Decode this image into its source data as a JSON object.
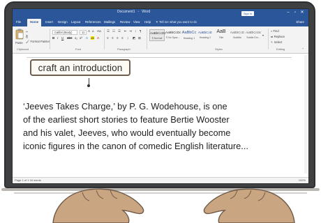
{
  "word": {
    "title_tokens": [
      "Document1",
      "-",
      "Word"
    ],
    "signin_label": "Sign in",
    "window_buttons": [
      "–",
      "▫",
      "✕"
    ],
    "tabs": [
      "File",
      "Home",
      "Insert",
      "Design",
      "Layout",
      "References",
      "Mailings",
      "Review",
      "View",
      "Help"
    ],
    "tell_me": "Tell me what you want to do",
    "share_label": "Share",
    "ribbon": {
      "font_name": "Calibri (Body)",
      "font_size": "11",
      "format_painter": "Format Painter",
      "paste_label": "Paste",
      "groups": [
        "Clipboard",
        "Font",
        "Paragraph",
        "Styles",
        "Editing"
      ],
      "styles": [
        {
          "sample": "AaBbCcDc",
          "name": "¶ Normal"
        },
        {
          "sample": "AaBbCcDc",
          "name": "¶ No Spac..."
        },
        {
          "sample": "AaBbCc",
          "name": "Heading 1"
        },
        {
          "sample": "AaBbCcE",
          "name": "Heading 2"
        },
        {
          "sample": "AaB",
          "name": "Title"
        },
        {
          "sample": "AaBbCcD",
          "name": "Subtitle"
        },
        {
          "sample": "AaBbCcDc",
          "name": "Subtle Em..."
        }
      ],
      "editing": [
        "Find",
        "Replace",
        "Select"
      ]
    },
    "callout_text": "craft an introduction",
    "paragraph_lines": [
      "‘Jeeves Takes Charge,’ by P. G. Wodehouse, is one",
      "of the earliest short stories to feature Bertie Wooster",
      "and his valet, Jeeves, who would eventually become",
      "iconic figures in the canon of comedic English literature..."
    ],
    "status_left": "Page 1 of 1   16 words",
    "status_zoom": "100%"
  },
  "colors": {
    "word_blue": "#2b579a",
    "bezel": "#3f4042",
    "hand": "#caa582",
    "callout_border": "#6f5e4d"
  }
}
